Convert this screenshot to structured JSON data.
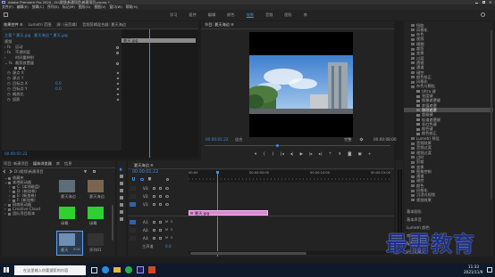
{
  "app": {
    "title": "Adobe Premiere Pro 2020 - D:\\视频\\新建项目\\新建项目.prproj *",
    "menu": [
      "文件(F)",
      "编辑(E)",
      "剪辑(C)",
      "序列(S)",
      "标记(M)",
      "图形(G)",
      "视图(V)",
      "窗口(W)",
      "帮助(H)"
    ],
    "workspaces": [
      "学习",
      "组件",
      "编辑",
      "颜色",
      "效果",
      "音频",
      "图形",
      "库"
    ],
    "active_workspace": "效果"
  },
  "effect_controls": {
    "tabs": [
      "效果控件 ≡",
      "Lumetri 范围",
      "源: (无剪辑)",
      "音频剪辑混合器: 夏天海边"
    ],
    "source_label": "主要 * 夏天.jpg",
    "clip_label": "夏天海边 * 夏天.jpg",
    "section_video": "视频",
    "motion": "运动",
    "opacity": "不透明度",
    "time_remap": "时间重映射",
    "effect_name": "裁剪放置器",
    "props": [
      {
        "label": "源点 X",
        "value": ""
      },
      {
        "label": "源点 Y",
        "value": ""
      },
      {
        "label": "目标点 X",
        "value": "0.0"
      },
      {
        "label": "目标点 Y",
        "value": "0.0"
      },
      {
        "label": "缩放比",
        "value": ""
      },
      {
        "label": "投影",
        "value": ""
      }
    ],
    "timecode": "00:00:01:22",
    "mini_clip": "夏天.jpg"
  },
  "program": {
    "tab": "节目: 夏天海边 ≡",
    "timecode_left": "00:00:01:22",
    "fit": "适合",
    "quality": "完整",
    "timecode_right": "00:00:08:00"
  },
  "project": {
    "tabs": [
      "项目: 新建项目",
      "媒体浏览器",
      "库",
      "信息"
    ],
    "path": "D:\\视频\\新建项目",
    "tree": [
      "收藏夹",
      "本地驱动器",
      "C: (本地磁盘)",
      "D: (新加卷)",
      "E: (新加卷)",
      "F: (新加卷)",
      "网络驱动器",
      "Creative Cloud",
      "团队项目版本"
    ],
    "thumbs": [
      {
        "name": "夏天海边",
        "dur": ""
      },
      {
        "name": "夏天海边",
        "dur": ""
      },
      {
        "name": "绿幕",
        "dur": ""
      },
      {
        "name": "绿幕",
        "dur": ""
      },
      {
        "name": "夏天",
        "dur": "5:00"
      },
      {
        "name": "序列01",
        "dur": ""
      }
    ]
  },
  "timeline": {
    "tab": "夏天海边 ≡",
    "timecode": "00:00:01:22",
    "tracks_v": [
      "V3",
      "V2",
      "V1"
    ],
    "tracks_a": [
      "A1",
      "A2",
      "A3"
    ],
    "master": "主声道",
    "master_val": "0.0",
    "clip_name": "夏天.jpg",
    "ruler": [
      "00:00",
      "00:00:05:00",
      "00:00:10:00",
      "00:00:15:00"
    ]
  },
  "effects_panel": {
    "items": [
      "扭曲",
      "风格化",
      "杂色",
      "视频",
      "模糊",
      "裁剪",
      "变换",
      "过渡",
      "透视",
      "通道",
      "键控",
      "颜色校正",
      "风格化",
      "杂色与颗粒",
      "Ultra 键",
      "亮度键",
      "图像遮罩键",
      "差值遮罩",
      "移除遮罩",
      "超级键",
      "轨道遮罩键",
      "非红色键",
      "颜色键",
      "颜色校正",
      "Lumetri 预设",
      "音频效果",
      "音频过渡",
      "视频过渡",
      "过时",
      "剪裁",
      "变换",
      "图像控制",
      "通道",
      "键控",
      "颜色",
      "风格化",
      "沉浸式视频",
      "视频效果"
    ],
    "highlight_index": 18,
    "sections": [
      "基本图形",
      "基本声音",
      "Lumetri 颜色",
      "库",
      "标记",
      "历史记录"
    ]
  },
  "watermark": "最需教育",
  "taskbar": {
    "search": "在这里输入你要搜索的内容",
    "time": "11:33",
    "date": "2021/11/9"
  }
}
